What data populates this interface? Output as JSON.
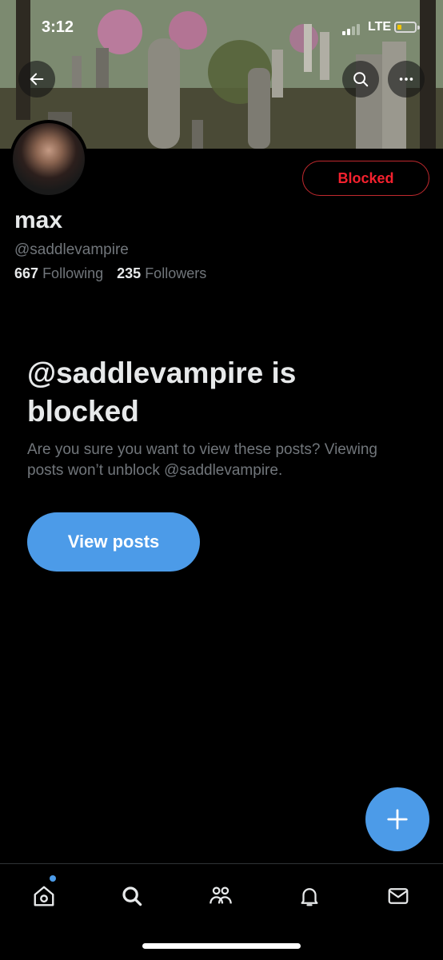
{
  "status_bar": {
    "time": "3:12",
    "network": "LTE"
  },
  "profile": {
    "display_name": "max",
    "handle": "@saddlevampire",
    "following_count": "667",
    "following_label": "Following",
    "followers_count": "235",
    "followers_label": "Followers",
    "blocked_button_label": "Blocked"
  },
  "blocked_notice": {
    "title": "@saddlevampire is blocked",
    "message": "Are you sure you want to view these posts? Viewing posts won’t unblock @saddlevampire.",
    "view_button_label": "View posts"
  },
  "icons": {
    "back": "back-arrow-icon",
    "search": "search-icon",
    "more": "more-icon",
    "compose": "plus-icon",
    "nav": [
      "home-icon",
      "search-icon",
      "communities-icon",
      "notifications-icon",
      "messages-icon"
    ]
  },
  "colors": {
    "background": "#000000",
    "accent": "#4c9be8",
    "blocked_red": "#f4212e",
    "secondary_text": "#71767b",
    "primary_text": "#e7e9ea"
  }
}
